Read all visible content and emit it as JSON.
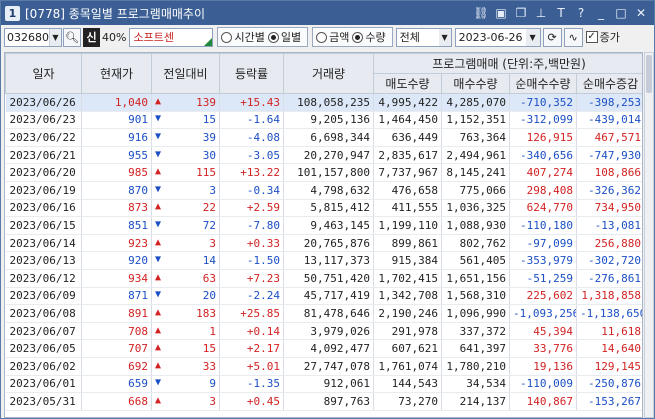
{
  "window": {
    "number": "1",
    "title": "[0778] 종목일별 프로그램매매추이",
    "icons": [
      "link-icon",
      "window-icon",
      "copy-icon",
      "pin-icon",
      "font-icon",
      "help-icon",
      "minimize-icon",
      "maximize-icon",
      "close-icon"
    ]
  },
  "toolbar": {
    "code": "032680",
    "sin_label": "신",
    "margin_pct": "40%",
    "stock_name": "소프트센",
    "period_options": [
      "시간별",
      "일별"
    ],
    "period_selected": "일별",
    "unit_options": [
      "금액",
      "수량"
    ],
    "unit_selected": "수량",
    "market_select": "전체",
    "date": "2023-06-26",
    "cumulative_label": "증가",
    "cumulative_checked": true
  },
  "table": {
    "headers": {
      "date": "일자",
      "price": "현재가",
      "change": "전일대비",
      "rate": "등락률",
      "volume": "거래량",
      "program_group": "프로그램매매 (단위:주,백만원)",
      "sell": "매도수량",
      "buy": "매수수량",
      "net": "순매수수량",
      "net_change": "순매수증감"
    },
    "rows": [
      {
        "date": "2023/06/26",
        "price": "1,040",
        "dir": "up",
        "change": "139",
        "rate": "+15.43",
        "volume": "108,058,235",
        "sell": "4,995,422",
        "buy": "4,285,070",
        "net": "-710,352",
        "net_change": "-398,253"
      },
      {
        "date": "2023/06/23",
        "price": "901",
        "dir": "dn",
        "change": "15",
        "rate": "-1.64",
        "volume": "9,205,136",
        "sell": "1,464,450",
        "buy": "1,152,351",
        "net": "-312,099",
        "net_change": "-439,014"
      },
      {
        "date": "2023/06/22",
        "price": "916",
        "dir": "dn",
        "change": "39",
        "rate": "-4.08",
        "volume": "6,698,344",
        "sell": "636,449",
        "buy": "763,364",
        "net": "126,915",
        "net_change": "467,571"
      },
      {
        "date": "2023/06/21",
        "price": "955",
        "dir": "dn",
        "change": "30",
        "rate": "-3.05",
        "volume": "20,270,947",
        "sell": "2,835,617",
        "buy": "2,494,961",
        "net": "-340,656",
        "net_change": "-747,930"
      },
      {
        "date": "2023/06/20",
        "price": "985",
        "dir": "up",
        "change": "115",
        "rate": "+13.22",
        "volume": "101,157,800",
        "sell": "7,737,967",
        "buy": "8,145,241",
        "net": "407,274",
        "net_change": "108,866"
      },
      {
        "date": "2023/06/19",
        "price": "870",
        "dir": "dn",
        "change": "3",
        "rate": "-0.34",
        "volume": "4,798,632",
        "sell": "476,658",
        "buy": "775,066",
        "net": "298,408",
        "net_change": "-326,362"
      },
      {
        "date": "2023/06/16",
        "price": "873",
        "dir": "up",
        "change": "22",
        "rate": "+2.59",
        "volume": "5,815,412",
        "sell": "411,555",
        "buy": "1,036,325",
        "net": "624,770",
        "net_change": "734,950"
      },
      {
        "date": "2023/06/15",
        "price": "851",
        "dir": "dn",
        "change": "72",
        "rate": "-7.80",
        "volume": "9,463,145",
        "sell": "1,199,110",
        "buy": "1,088,930",
        "net": "-110,180",
        "net_change": "-13,081"
      },
      {
        "date": "2023/06/14",
        "price": "923",
        "dir": "up",
        "change": "3",
        "rate": "+0.33",
        "volume": "20,765,876",
        "sell": "899,861",
        "buy": "802,762",
        "net": "-97,099",
        "net_change": "256,880"
      },
      {
        "date": "2023/06/13",
        "price": "920",
        "dir": "dn",
        "change": "14",
        "rate": "-1.50",
        "volume": "13,117,373",
        "sell": "915,384",
        "buy": "561,405",
        "net": "-353,979",
        "net_change": "-302,720"
      },
      {
        "date": "2023/06/12",
        "price": "934",
        "dir": "up",
        "change": "63",
        "rate": "+7.23",
        "volume": "50,751,420",
        "sell": "1,702,415",
        "buy": "1,651,156",
        "net": "-51,259",
        "net_change": "-276,861"
      },
      {
        "date": "2023/06/09",
        "price": "871",
        "dir": "dn",
        "change": "20",
        "rate": "-2.24",
        "volume": "45,717,419",
        "sell": "1,342,708",
        "buy": "1,568,310",
        "net": "225,602",
        "net_change": "1,318,858"
      },
      {
        "date": "2023/06/08",
        "price": "891",
        "dir": "up",
        "change": "183",
        "rate": "+25.85",
        "volume": "81,478,646",
        "sell": "2,190,246",
        "buy": "1,096,990",
        "net": "-1,093,256",
        "net_change": "-1,138,650"
      },
      {
        "date": "2023/06/07",
        "price": "708",
        "dir": "up",
        "change": "1",
        "rate": "+0.14",
        "volume": "3,979,026",
        "sell": "291,978",
        "buy": "337,372",
        "net": "45,394",
        "net_change": "11,618"
      },
      {
        "date": "2023/06/05",
        "price": "707",
        "dir": "up",
        "change": "15",
        "rate": "+2.17",
        "volume": "4,092,477",
        "sell": "607,621",
        "buy": "641,397",
        "net": "33,776",
        "net_change": "14,640"
      },
      {
        "date": "2023/06/02",
        "price": "692",
        "dir": "up",
        "change": "33",
        "rate": "+5.01",
        "volume": "27,747,078",
        "sell": "1,761,074",
        "buy": "1,780,210",
        "net": "19,136",
        "net_change": "129,145"
      },
      {
        "date": "2023/06/01",
        "price": "659",
        "dir": "dn",
        "change": "9",
        "rate": "-1.35",
        "volume": "912,061",
        "sell": "144,543",
        "buy": "34,534",
        "net": "-110,009",
        "net_change": "-250,876"
      },
      {
        "date": "2023/05/31",
        "price": "668",
        "dir": "up",
        "change": "3",
        "rate": "+0.45",
        "volume": "897,763",
        "sell": "73,270",
        "buy": "214,137",
        "net": "140,867",
        "net_change": "-153,267"
      }
    ]
  },
  "colors": {
    "up": "#d22222",
    "down": "#1b4fc4",
    "title_bar": "#3b5f95",
    "header_bg": "#e7ebf1",
    "selected_row": "#dce8f7"
  }
}
